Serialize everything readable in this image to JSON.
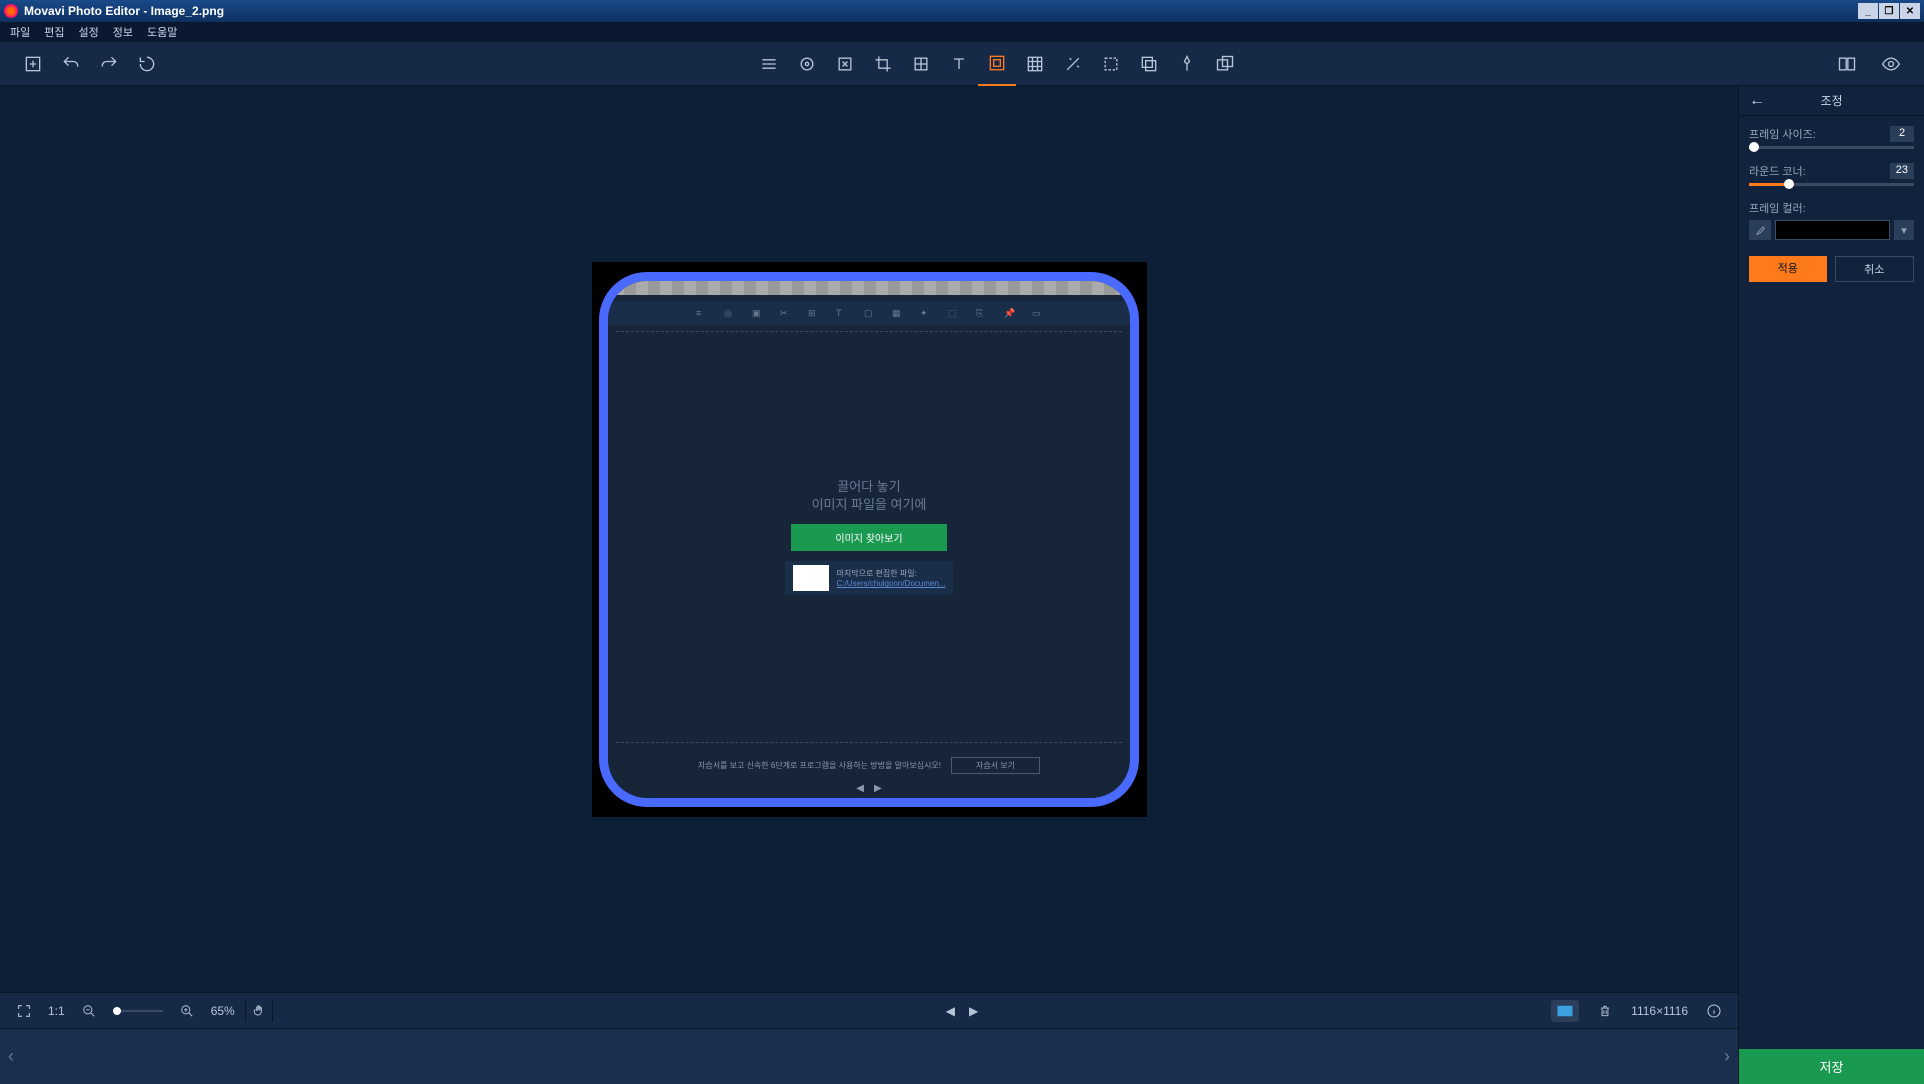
{
  "titlebar": {
    "text": "Movavi Photo Editor - Image_2.png"
  },
  "menu": {
    "items": [
      "파일",
      "편집",
      "설정",
      "정보",
      "도움말"
    ]
  },
  "bottombar": {
    "scale_label": "1:1",
    "zoom_pct": "65%",
    "dimensions": "1116×1116"
  },
  "panel": {
    "title": "조정",
    "frame_size_label": "프레임 사이즈:",
    "frame_size_value": "2",
    "round_corner_label": "라운드 코너:",
    "round_corner_value": "23",
    "frame_color_label": "프레임 컬러:",
    "apply": "적용",
    "cancel": "취소"
  },
  "save": {
    "label": "저장"
  },
  "inner": {
    "drop_line1": "끌어다 놓기",
    "drop_line2": "이미지 파일을 여기에",
    "browse": "이미지 찾아보기",
    "recent_label": "마지막으로 편집한 파일:",
    "recent_path": "C:/Users/chulgoon/Documen...",
    "tutorial_text": "자습서를 보고 신속한 6단계로 프로그램을 사용하는 방법을 알아보십시오!",
    "tutorial_btn": "자습서 보기"
  }
}
